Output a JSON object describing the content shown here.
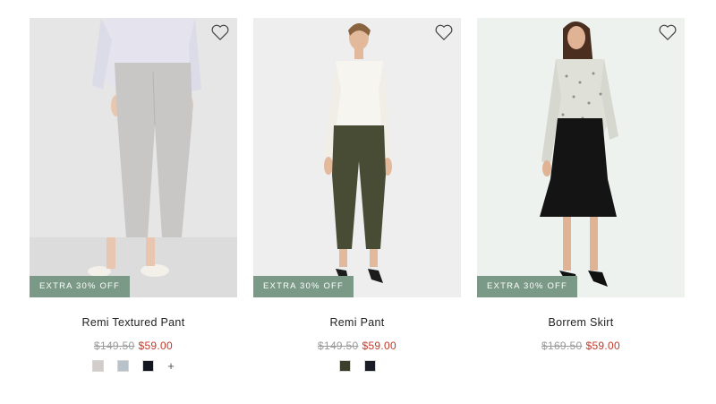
{
  "products": [
    {
      "name": "Remi Textured Pant",
      "badge": "EXTRA 30% OFF",
      "original_price": "$149.50",
      "sale_price": "$59.00",
      "swatches": [
        "#d2cdca",
        "#b8c2c8",
        "#14161f"
      ],
      "more_colors": "+"
    },
    {
      "name": "Remi Pant",
      "badge": "EXTRA 30% OFF",
      "original_price": "$149.50",
      "sale_price": "$59.00",
      "swatches": [
        "#3c3f2c",
        "#1b1d26"
      ]
    },
    {
      "name": "Borrem Skirt",
      "badge": "EXTRA 30% OFF",
      "original_price": "$169.50",
      "sale_price": "$59.00",
      "swatches": []
    }
  ],
  "colors": {
    "badge_bg": "#7b9987",
    "sale": "#c0392b",
    "original": "#9a9a9a"
  },
  "icons": {
    "wishlist": "heart-outline-icon"
  }
}
